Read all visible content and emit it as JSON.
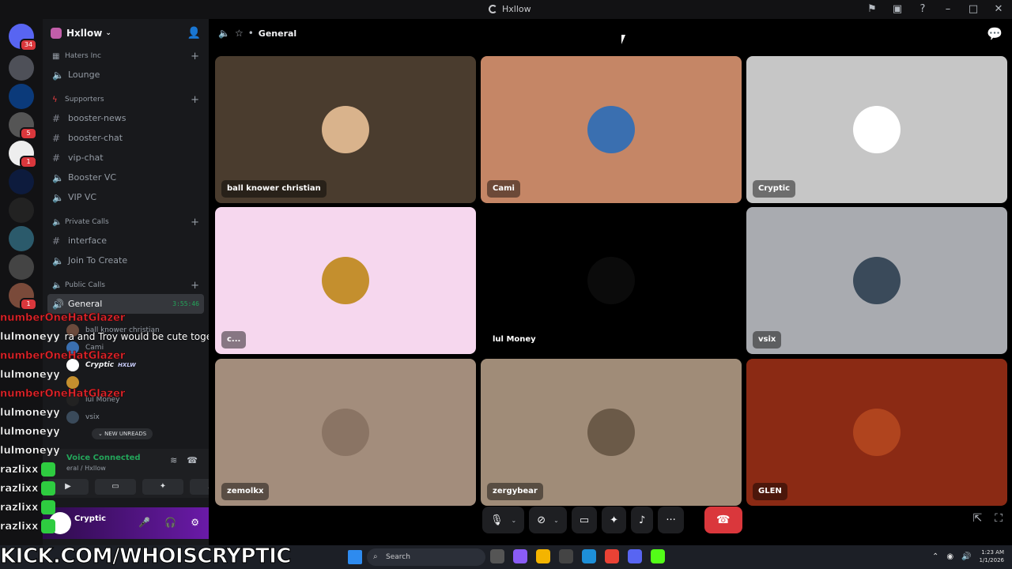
{
  "window": {
    "title": "Hxllow"
  },
  "rail": {
    "badges": [
      "34",
      "5",
      "1",
      "1"
    ]
  },
  "server": {
    "name": "Hxllow"
  },
  "categories": {
    "haters": "Haters Inc",
    "supporters": "Supporters",
    "private": "Private Calls",
    "public": "Public Calls"
  },
  "channels": {
    "lounge": "Lounge",
    "booster_news": "booster-news",
    "booster_chat": "booster-chat",
    "vip_chat": "vip-chat",
    "booster_vc": "Booster VC",
    "vip_vc": "VIP VC",
    "interface": "interface",
    "join_to_create": "Join To Create",
    "general": "General",
    "general_time": "3:55:46"
  },
  "voice_members": {
    "m1": "ball knower christian",
    "m2": "Cami",
    "m3": "Cryptic",
    "m3_tag": "HXLW",
    "m5": "lul Money",
    "m6": "vsix"
  },
  "new_unreads": "NEW UNREADS",
  "voice_panel": {
    "status": "Voice Connected",
    "sub": "eral / Hxllow"
  },
  "user_panel": {
    "name": "Cryptic"
  },
  "overlay": {
    "lines": [
      {
        "name": "numberOneHatGlazer",
        "msg": ""
      },
      {
        "name": "lulmoneyy",
        "msg": "ra and Troy would be cute together"
      },
      {
        "name": "numberOneHatGlazer",
        "msg": ""
      },
      {
        "name": "lulmoneyy",
        "msg": ""
      },
      {
        "name": "numberOneHatGlazer",
        "msg": ""
      },
      {
        "name": "lulmoneyy",
        "msg": ""
      },
      {
        "name": "lulmoneyy",
        "msg": ""
      },
      {
        "name": "lulmoneyy",
        "msg": ""
      },
      {
        "name": "razlixx",
        "msg": ""
      },
      {
        "name": "razlixx",
        "msg": ""
      },
      {
        "name": "razlixx",
        "msg": ""
      },
      {
        "name": "razlixx",
        "msg": ""
      }
    ]
  },
  "main": {
    "channel": "General"
  },
  "tiles": [
    {
      "name": "ball knower christian",
      "bg": "#4a3c2e",
      "av": "#d9b38c"
    },
    {
      "name": "Cami",
      "bg": "#c58666",
      "av": "#3a6fb0"
    },
    {
      "name": "Cryptic",
      "bg": "#c6c6c6",
      "av": "#ffffff"
    },
    {
      "name": "c...",
      "bg": "#f6d7ee",
      "av": "#c48f2e"
    },
    {
      "name": "lul Money",
      "bg": "#000000",
      "av": "#0b0b0b"
    },
    {
      "name": "vsix",
      "bg": "#a9abb0",
      "av": "#3a4a5a"
    },
    {
      "name": "zemolkx",
      "bg": "#a38d7c",
      "av": "#8a7464"
    },
    {
      "name": "zergybear",
      "bg": "#a08c78",
      "av": "#6b5a48"
    },
    {
      "name": "GLEN",
      "bg": "#8b2a14",
      "av": "#b0441e"
    }
  ],
  "taskbar": {
    "watermark": "KICK.COM/WHOISCRYPTIC",
    "search": "Search",
    "time": "1:23 AM",
    "date": "1/1/2026"
  },
  "colors": {
    "accent_green": "#23a55a",
    "hangup_red": "#da373c",
    "overlay_red": "#e2262c"
  }
}
